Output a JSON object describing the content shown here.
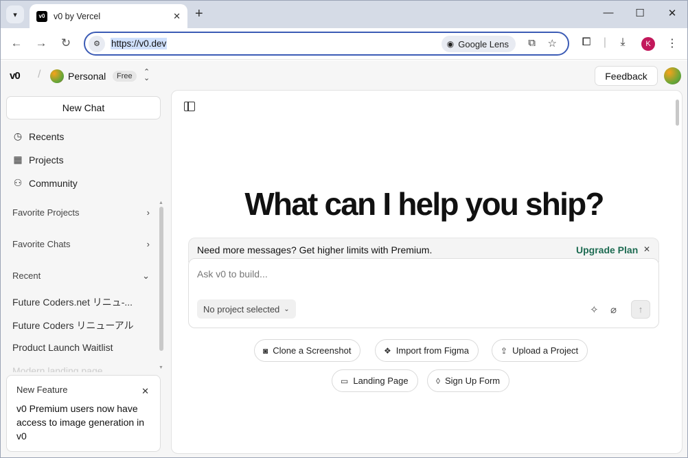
{
  "browser": {
    "tab_title": "v0 by Vercel",
    "favicon_text": "v0",
    "url": "https://v0.dev",
    "lens_label": "Google Lens",
    "profile_initial": "K"
  },
  "header": {
    "logo": "v0",
    "workspace_name": "Personal",
    "plan_badge": "Free",
    "feedback_label": "Feedback"
  },
  "sidebar": {
    "new_chat_label": "New Chat",
    "nav": [
      {
        "label": "Recents",
        "icon": "clock-icon"
      },
      {
        "label": "Projects",
        "icon": "grid-icon"
      },
      {
        "label": "Community",
        "icon": "community-icon"
      }
    ],
    "sections": {
      "favorite_projects": "Favorite Projects",
      "favorite_chats": "Favorite Chats",
      "recent": "Recent"
    },
    "recent_items": [
      "Future Coders.net リニュ-...",
      "Future Coders リニューアル",
      "Product Launch Waitlist",
      "Modern landing page"
    ],
    "feature_card": {
      "title": "New Feature",
      "text": "v0 Premium users now have access to image generation in v0"
    }
  },
  "main": {
    "headline": "What can I help you ship?",
    "promo_text": "Need more messages? Get higher limits with Premium.",
    "upgrade_label": "Upgrade Plan",
    "composer_placeholder": "Ask v0 to build...",
    "project_select": "No project selected",
    "suggestions": [
      "Clone a Screenshot",
      "Import from Figma",
      "Upload a Project",
      "Landing Page",
      "Sign Up Form"
    ]
  },
  "colors": {
    "accent": "#1d6b52",
    "omnibox_border": "#3b5bb5",
    "profile": "#c2185b"
  }
}
